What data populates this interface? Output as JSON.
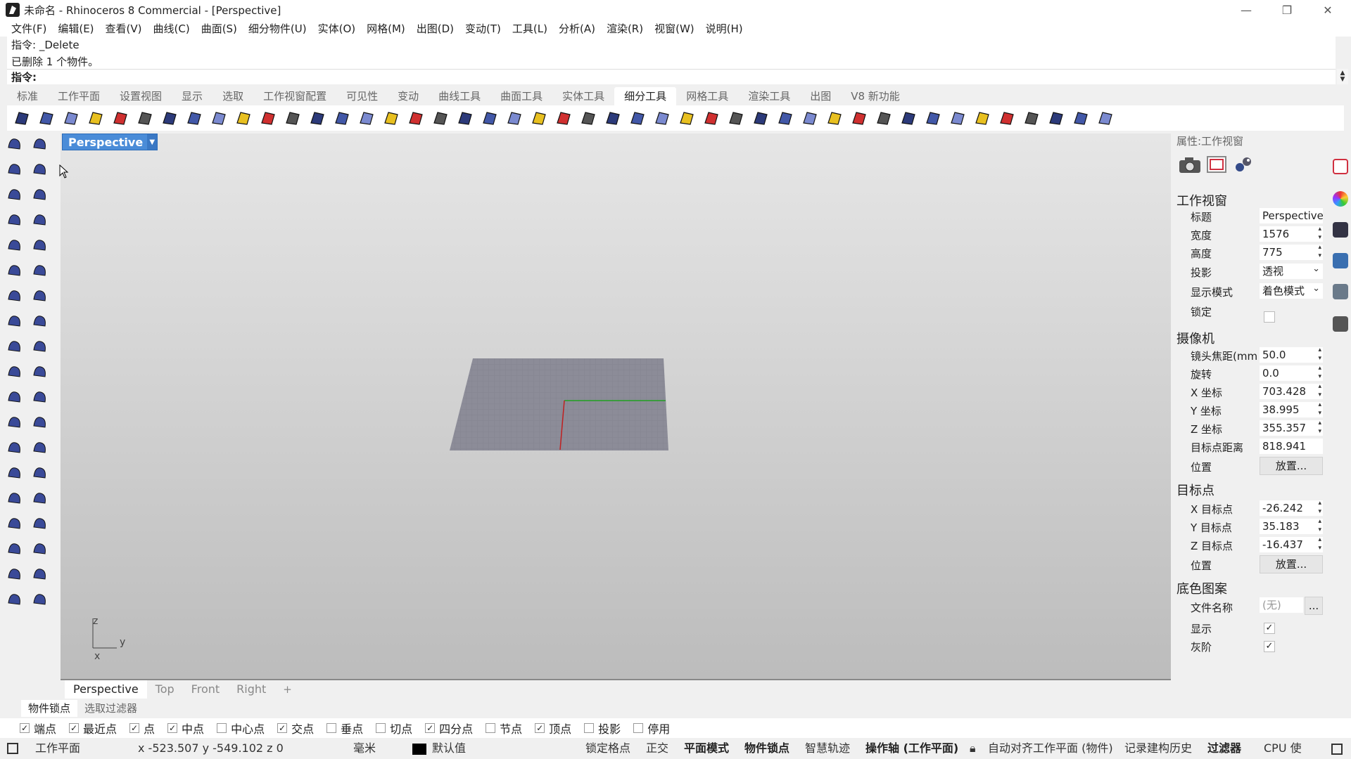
{
  "window": {
    "title": "未命名 - Rhinoceros 8 Commercial - [Perspective]",
    "minimize": "—",
    "maximize": "❐",
    "close": "✕"
  },
  "menu": [
    "文件(F)",
    "编辑(E)",
    "查看(V)",
    "曲线(C)",
    "曲面(S)",
    "细分物件(U)",
    "实体(O)",
    "网格(M)",
    "出图(D)",
    "变动(T)",
    "工具(L)",
    "分析(A)",
    "渲染(R)",
    "视窗(W)",
    "说明(H)"
  ],
  "command": {
    "history_line1": "指令: _Delete",
    "history_line2": "已删除 1 个物件。",
    "prompt": "指令:"
  },
  "tool_tabs": {
    "items": [
      "标准",
      "工作平面",
      "设置视图",
      "显示",
      "选取",
      "工作视窗配置",
      "可见性",
      "变动",
      "曲线工具",
      "曲面工具",
      "实体工具",
      "细分工具",
      "网格工具",
      "渲染工具",
      "出图",
      "V8 新功能"
    ],
    "active_index": 11
  },
  "viewport": {
    "label": "Perspective",
    "axis_z": "z",
    "axis_y": "y",
    "axis_x": "x",
    "tabs": [
      "Perspective",
      "Top",
      "Front",
      "Right"
    ],
    "add_tab": "+",
    "active_tab": 0
  },
  "properties": {
    "header": "属性:工作视窗",
    "section_viewport": "工作视窗",
    "title_label": "标题",
    "title_value": "Perspective",
    "width_label": "宽度",
    "width_value": "1576",
    "height_label": "高度",
    "height_value": "775",
    "projection_label": "投影",
    "projection_value": "透视",
    "display_mode_label": "显示模式",
    "display_mode_value": "着色模式",
    "lock_label": "锁定",
    "section_camera": "摄像机",
    "focal_label": "镜头焦距(mm)",
    "focal_value": "50.0",
    "rotation_label": "旋转",
    "rotation_value": "0.0",
    "cam_x_label": "X 坐标",
    "cam_x_value": "703.428",
    "cam_y_label": "Y 坐标",
    "cam_y_value": "38.995",
    "cam_z_label": "Z 坐标",
    "cam_z_value": "355.357",
    "target_dist_label": "目标点距离",
    "target_dist_value": "818.941",
    "position_label": "位置",
    "place_button": "放置...",
    "section_target": "目标点",
    "tgt_x_label": "X 目标点",
    "tgt_x_value": "-26.242",
    "tgt_y_label": "Y 目标点",
    "tgt_y_value": "35.183",
    "tgt_z_label": "Z 目标点",
    "tgt_z_value": "-16.437",
    "section_wallpaper": "底色图案",
    "filename_label": "文件名称",
    "filename_value": "(无)",
    "browse_button": "...",
    "show_label": "显示",
    "gray_label": "灰阶",
    "checked_mark": "✓"
  },
  "osnap": {
    "tabs": [
      "物件锁点",
      "选取过滤器"
    ],
    "items": [
      {
        "label": "端点",
        "checked": true
      },
      {
        "label": "最近点",
        "checked": true
      },
      {
        "label": "点",
        "checked": true
      },
      {
        "label": "中点",
        "checked": true
      },
      {
        "label": "中心点",
        "checked": false
      },
      {
        "label": "交点",
        "checked": true
      },
      {
        "label": "垂点",
        "checked": false
      },
      {
        "label": "切点",
        "checked": false
      },
      {
        "label": "四分点",
        "checked": true
      },
      {
        "label": "节点",
        "checked": false
      },
      {
        "label": "顶点",
        "checked": true
      },
      {
        "label": "投影",
        "checked": false
      },
      {
        "label": "停用",
        "checked": false
      }
    ]
  },
  "status": {
    "cplane": "工作平面",
    "coords": "x -523.507  y -549.102  z 0",
    "units": "毫米",
    "layer": "默认值",
    "layer_color": "#000000",
    "grid_snap": "锁定格点",
    "ortho": "正交",
    "planar": "平面模式",
    "osnap": "物件锁点",
    "smarttrack": "智慧轨迹",
    "gumball": "操作轴 (工作平面)",
    "autoalign": "自动对齐工作平面 (物件)",
    "history": "记录建构历史",
    "filter": "过滤器",
    "cpu": "CPU 使"
  },
  "colors": {
    "accent": "#4a8cd8",
    "grid": "#8a8a96",
    "x_axis": "#c02020",
    "y_axis": "#20a020"
  }
}
